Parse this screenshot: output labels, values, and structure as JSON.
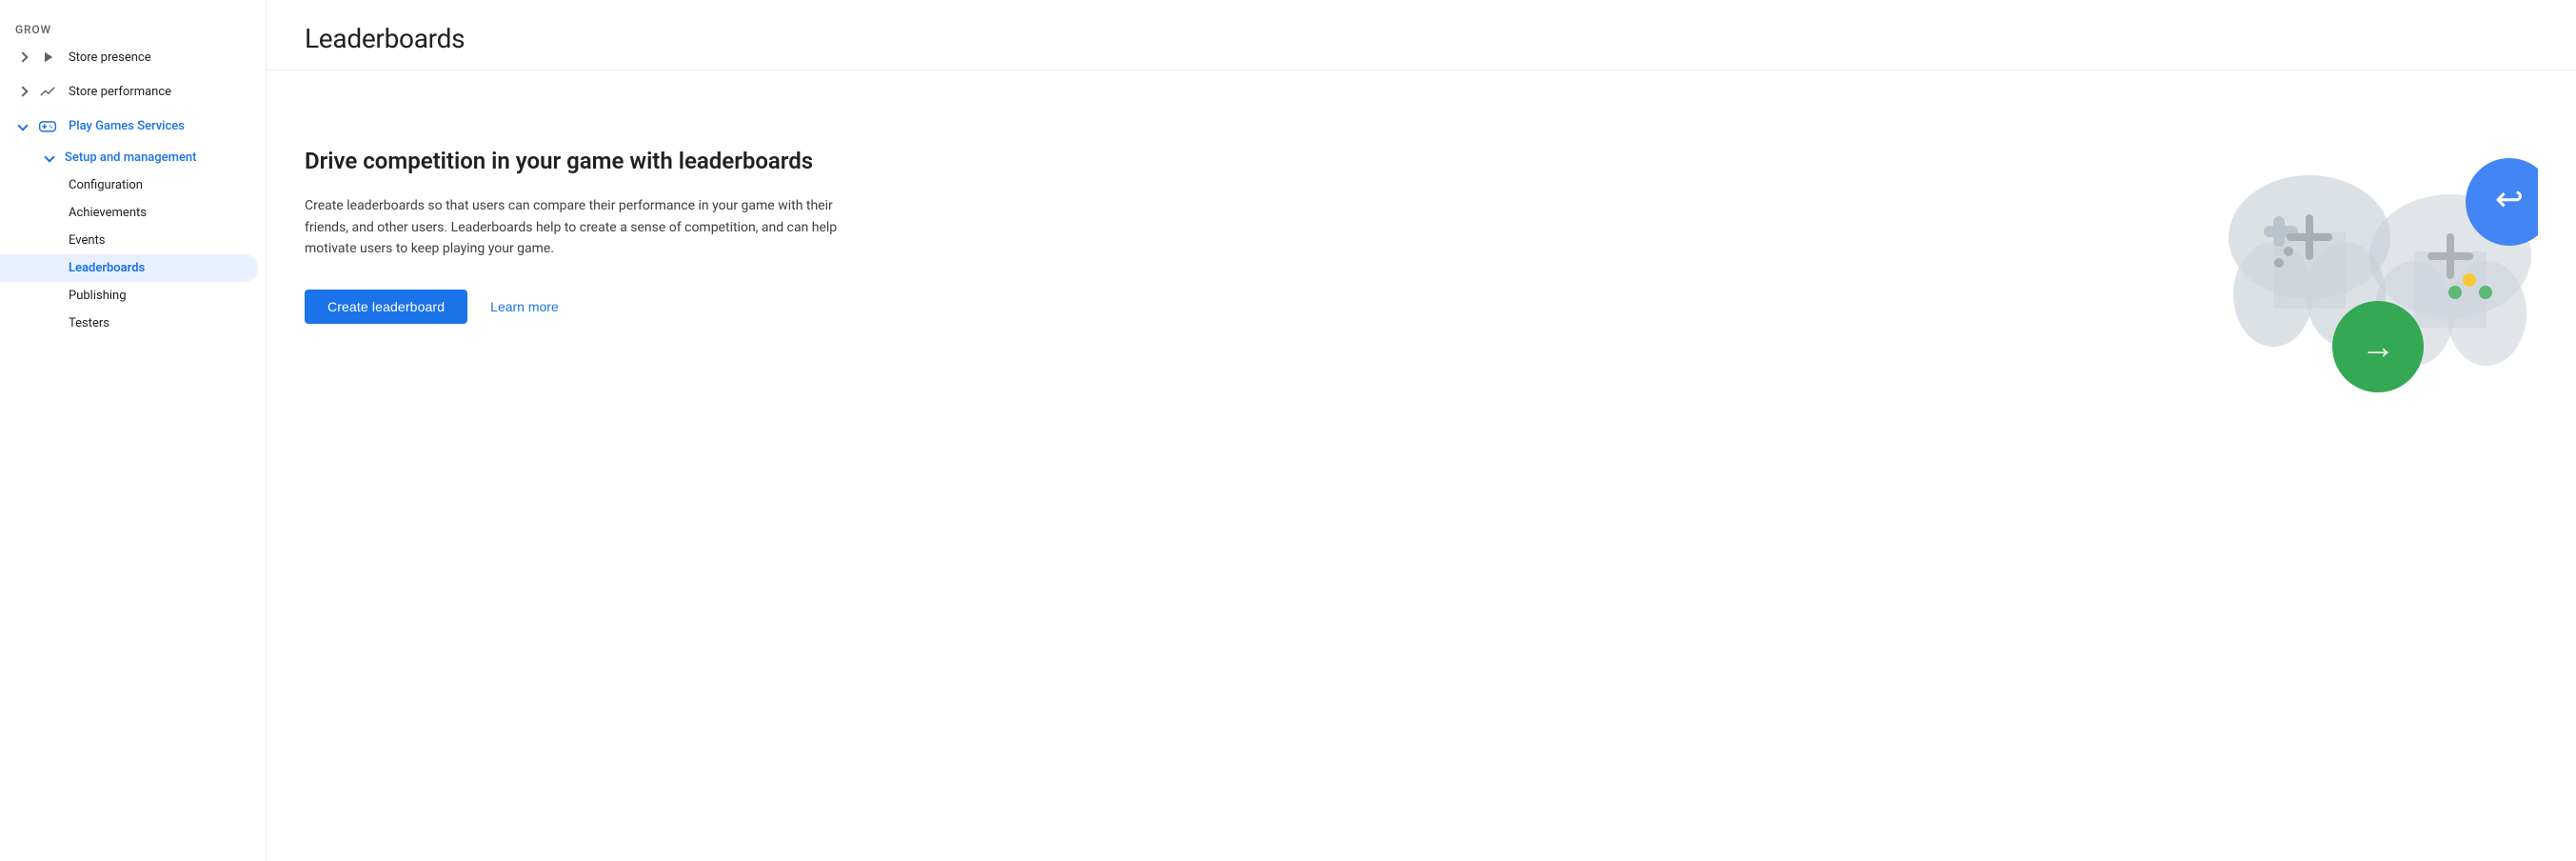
{
  "sidebar": {
    "section_label": "Grow",
    "items": [
      {
        "id": "store-presence",
        "label": "Store presence",
        "icon": "play-icon",
        "expanded": false,
        "active": false,
        "level": 1
      },
      {
        "id": "store-performance",
        "label": "Store performance",
        "icon": "chart-icon",
        "expanded": false,
        "active": false,
        "level": 1
      },
      {
        "id": "play-games-services",
        "label": "Play Games Services",
        "icon": "gamepad-icon",
        "expanded": true,
        "active": true,
        "level": 1,
        "children": [
          {
            "id": "setup-and-management",
            "label": "Setup and management",
            "expanded": true,
            "active": false,
            "level": 2,
            "children": [
              {
                "id": "configuration",
                "label": "Configuration",
                "active": false,
                "level": 3
              },
              {
                "id": "achievements",
                "label": "Achievements",
                "active": false,
                "level": 3
              },
              {
                "id": "events",
                "label": "Events",
                "active": false,
                "level": 3
              },
              {
                "id": "leaderboards",
                "label": "Leaderboards",
                "active": true,
                "level": 3
              },
              {
                "id": "publishing",
                "label": "Publishing",
                "active": false,
                "level": 3
              },
              {
                "id": "testers",
                "label": "Testers",
                "active": false,
                "level": 3
              }
            ]
          }
        ]
      }
    ]
  },
  "main": {
    "title": "Leaderboards",
    "hero_title": "Drive competition in your game with leaderboards",
    "hero_description": "Create leaderboards so that users can compare their performance in your game with their friends, and other users. Leaderboards help to create a sense of competition, and can help motivate users to keep playing your game.",
    "create_button_label": "Create leaderboard",
    "learn_more_label": "Learn more"
  },
  "illustration": {
    "controller_color": "#c5cdd6",
    "blue_circle_color": "#4285f4",
    "green_circle_color": "#34a853",
    "yellow_dot_color": "#fbbc04",
    "green_dot_color": "#34a853",
    "plus_color": "#9aa0a6",
    "arrow_color": "#ffffff"
  }
}
